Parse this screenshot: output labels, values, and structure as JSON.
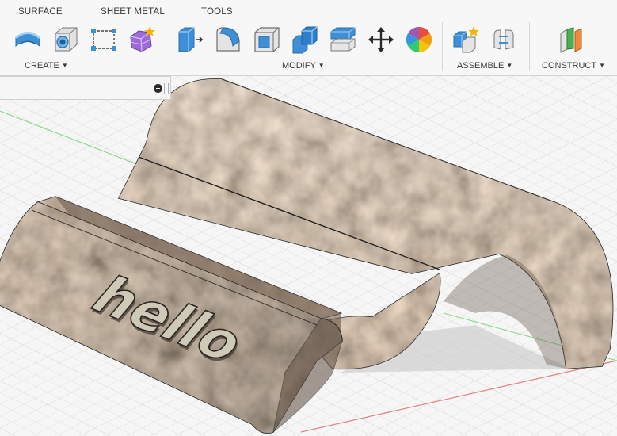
{
  "toolbar": {
    "tabs": [
      {
        "label": "SURFACE"
      },
      {
        "label": "SHEET METAL"
      },
      {
        "label": "TOOLS"
      }
    ],
    "groups": {
      "create": "CREATE",
      "modify": "MODIFY",
      "assemble": "ASSEMBLE",
      "construct": "CONSTRUCT"
    },
    "icons": {
      "create": [
        "extrude-partial-icon",
        "revolve-icon",
        "hole-icon",
        "sketch-rectangle-icon",
        "create-form-icon"
      ],
      "modify": [
        "press-pull-icon",
        "fillet-icon",
        "shell-icon",
        "combine-icon",
        "split-body-icon",
        "move-icon",
        "appearance-icon"
      ],
      "assemble": [
        "new-component-icon",
        "joint-icon"
      ],
      "construct": [
        "offset-plane-icon"
      ]
    }
  },
  "viewport": {
    "embossed_text": "hello",
    "colors": {
      "body_base": "#8a7462",
      "emboss": "#cfc9b8",
      "grid": "#cfcfcf",
      "axis_green": "#88d888",
      "axis_red": "#e88080"
    }
  }
}
